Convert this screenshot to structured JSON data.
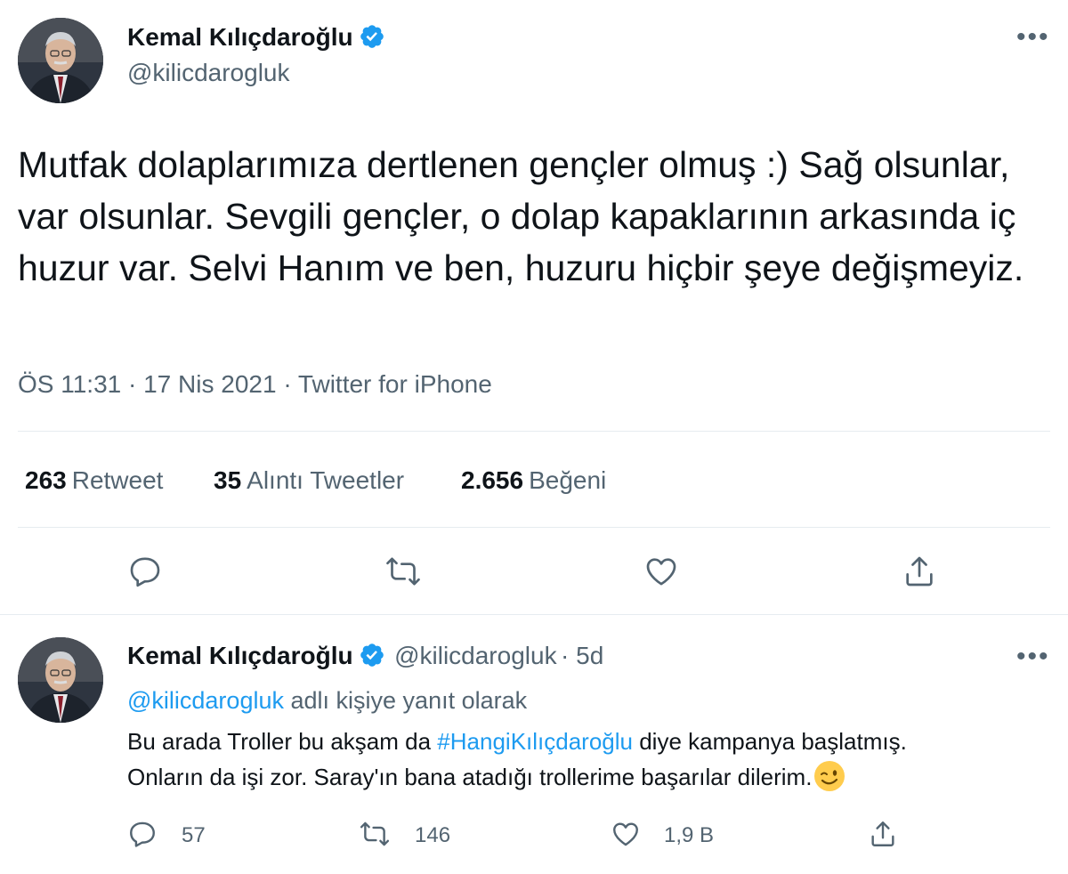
{
  "tweet": {
    "author_name": "Kemal Kılıçdaroğlu",
    "author_handle": "@kilicdarogluk",
    "text": "Mutfak dolaplarımıza dertlenen gençler olmuş :) Sağ olsunlar, var olsunlar. Sevgili gençler, o dolap kapaklarının arkasında iç huzur var. Selvi Hanım ve ben, huzuru hiçbir şeye değişmeyiz.",
    "timestamp": "ÖS 11:31 · 17 Nis 2021 · Twitter for iPhone",
    "stats": {
      "retweets_count": "263",
      "retweets_label": "Retweet",
      "quotes_count": "35",
      "quotes_label": "Alıntı Tweetler",
      "likes_count": "2.656",
      "likes_label": "Beğeni"
    },
    "icons": [
      "reply-icon",
      "retweet-icon",
      "like-icon",
      "share-icon",
      "verified-icon",
      "more-icon"
    ]
  },
  "reply": {
    "author_name": "Kemal Kılıçdaroğlu",
    "author_handle": "@kilicdarogluk",
    "time": "· 5d",
    "replying_to_handle": "@kilicdarogluk",
    "replying_to_label": "adlı kişiye yanıt olarak",
    "text_line1_before": "Bu arada Troller bu akşam da ",
    "hashtag": "#HangiKılıçdaroğlu",
    "text_line1_after": " diye kampanya başlatmış.",
    "text_line2": "Onların da işi zor. Saray'ın bana atadığı trollerime başarılar dilerim.",
    "emoji": "winking-face",
    "replies_count": "57",
    "retweets_count": "146",
    "likes_count": "1,9 B"
  },
  "colors": {
    "link": "#1d9bf0",
    "secondary_text": "#536471",
    "primary_text": "#0f1419",
    "divider": "#e6ecf0"
  }
}
